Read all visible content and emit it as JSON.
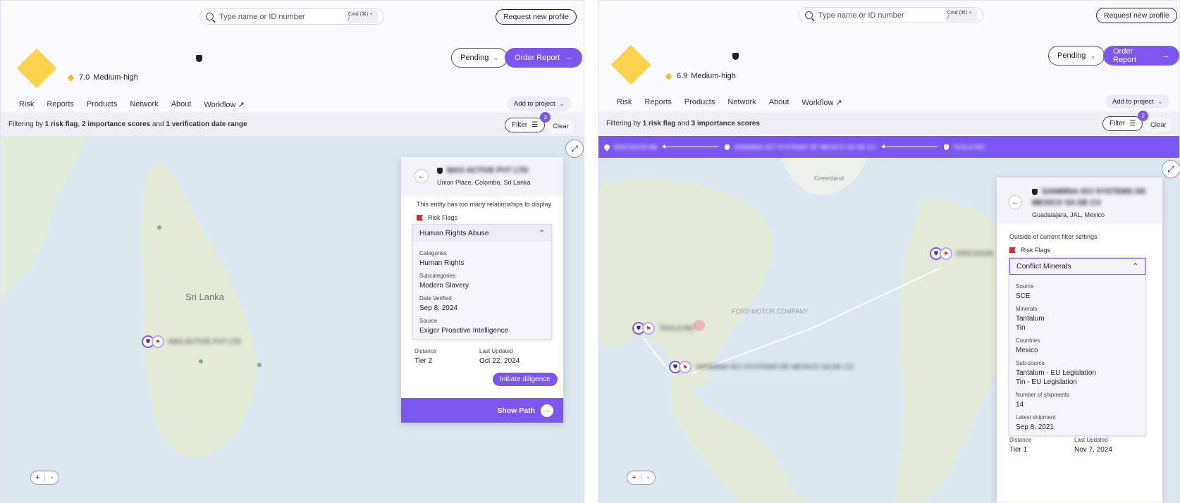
{
  "left": {
    "search": {
      "placeholder": "Type name or ID number",
      "shortcut": "Cmd (⌘) + /"
    },
    "request_button": "Request new profile",
    "score": {
      "value": "7.0",
      "label": "Medium-high"
    },
    "pending_label": "Pending",
    "order_label": "Order Report",
    "tabs": [
      "Risk",
      "Reports",
      "Products",
      "Network",
      "About",
      "Workflow ↗"
    ],
    "active_tab": "Network",
    "add_project": "Add to project",
    "filter_text_parts": [
      "Filtering by ",
      "1 risk flag",
      ", ",
      "2 importance scores",
      " and ",
      "1 verification date range"
    ],
    "filter_label": "Filter",
    "filter_count": "3",
    "clear_label": "Clear",
    "map_labels": {
      "country": "Sri Lanka"
    },
    "node_label": "MAS ACTIVE PVT LTD",
    "card": {
      "title": "MAS ACTIVE PVT LTD",
      "location": "Union Place, Colombo, Sri Lanka",
      "note": "This entity has too many relationships to display",
      "risk_flags_label": "Risk Flags",
      "accordion_title": "Human Rights Abuse",
      "fields": [
        {
          "label": "Categories",
          "value": "Human Rights"
        },
        {
          "label": "Subcategories",
          "value": "Modern Slavery"
        },
        {
          "label": "Date Verified",
          "value": "Sep 8, 2024"
        },
        {
          "label": "Source",
          "value": "Exiger Proactive Intelligence"
        }
      ],
      "distance_label": "Distance",
      "distance_value": "Tier 2",
      "updated_label": "Last Updated",
      "updated_value": "Oct 22, 2024",
      "initiate_label": "Initiate diligence",
      "show_path_label": "Show Path"
    }
  },
  "right": {
    "search": {
      "placeholder": "Type name or ID number",
      "shortcut": "Cmd (⌘) + /"
    },
    "request_button": "Request new profile",
    "score": {
      "value": "6.9",
      "label": "Medium-high"
    },
    "pending_label": "Pending",
    "order_label": "Order Report",
    "tabs": [
      "Risk",
      "Reports",
      "Products",
      "Network",
      "About",
      "Workflow ↗"
    ],
    "active_tab": "Network",
    "add_project": "Add to project",
    "filter_text_parts": [
      "Filtering by ",
      "1 risk flag",
      " and ",
      "3 importance scores"
    ],
    "filter_label": "Filter",
    "filter_count": "2",
    "clear_label": "Clear",
    "path": [
      "ERICSSON AB",
      "SANMINA-SCI SYSTEMS DE MEXICO SA DE CV",
      "TESLA INC"
    ],
    "map_labels": {
      "greenland": "Greenland",
      "ford": "FORD MOTOR COMPANY"
    },
    "nodes": [
      "TESLA INC",
      "SANMINA-SCI SYSTEMS DE MEXICO SA DE CV",
      "ERICSSON"
    ],
    "card": {
      "title": "SANMINA-SCI SYSTEMS DE MEXICO SA DE CV",
      "location": "Guadalajara, JAL, Mexico",
      "note": "Outside of current filter settings",
      "risk_flags_label": "Risk Flags",
      "accordion_title": "Conflict Minerals",
      "fields": [
        {
          "label": "Source",
          "value": "SCE"
        },
        {
          "label": "Minerals",
          "value": "Tantalum\nTin"
        },
        {
          "label": "Countries",
          "value": "Mexico"
        },
        {
          "label": "Sub-source",
          "value": "Tantalum - EU Legislation\nTin - EU Legislation"
        },
        {
          "label": "Number of shipments",
          "value": "14"
        },
        {
          "label": "Latest shipment",
          "value": "Sep 8, 2021"
        }
      ],
      "distance_label": "Distance",
      "distance_value": "Tier 1",
      "updated_label": "Last Updated",
      "updated_value": "Nov 7, 2024"
    }
  },
  "colors": {
    "accent": "#7b57f0",
    "score": "#f3bd32",
    "logo": "#fdd24f",
    "flag": "#d32a2a",
    "map": "#dde7f0"
  }
}
